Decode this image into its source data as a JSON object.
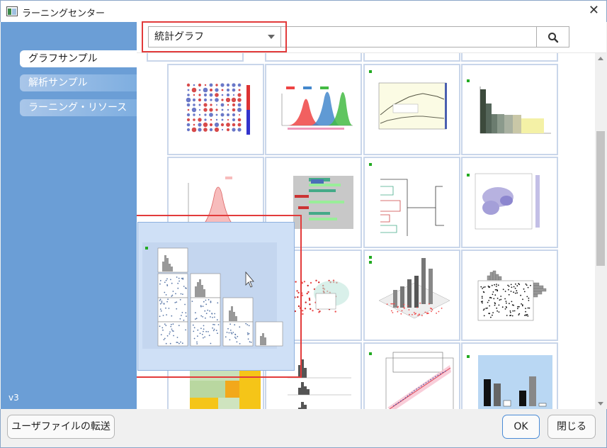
{
  "window": {
    "title": "ラーニングセンター",
    "close_glyph": "✕"
  },
  "sidebar": {
    "items": [
      {
        "label": "グラフサンプル",
        "state": "active"
      },
      {
        "label": "解析サンプル",
        "state": "inactive"
      },
      {
        "label": "ラーニング・リソース",
        "state": "inactive"
      }
    ],
    "version": "v3"
  },
  "search": {
    "category_value": "統計グラフ",
    "search_icon": "magnifier-icon"
  },
  "gallery": {
    "thumbnails": [
      {
        "name": "correlation-dot-matrix"
      },
      {
        "name": "overlapping-density-curves"
      },
      {
        "name": "line-series-with-band"
      },
      {
        "name": "histogram-bars"
      },
      {
        "name": "histogram-with-distribution-curve"
      },
      {
        "name": "horizontal-bar-chart"
      },
      {
        "name": "dendrogram"
      },
      {
        "name": "2d-kernel-density"
      },
      {
        "name": "scatter-with-density"
      },
      {
        "name": "3d-bar-chart"
      },
      {
        "name": "scatter-with-marginal-histograms"
      },
      {
        "name": "heatmap-table"
      },
      {
        "name": "stacked-histograms"
      },
      {
        "name": "probability-plot"
      },
      {
        "name": "bar-chart-with-error-bars"
      }
    ],
    "drag_preview": {
      "name": "scatter-matrix-histograms"
    }
  },
  "colors": {
    "sidebar": "#6b9ed6",
    "highlight": "#e23b3b",
    "accent": "#4a8bd6"
  },
  "footer": {
    "transfer_label": "ユーザファイルの転送",
    "ok_label": "OK",
    "close_label": "閉じる"
  }
}
